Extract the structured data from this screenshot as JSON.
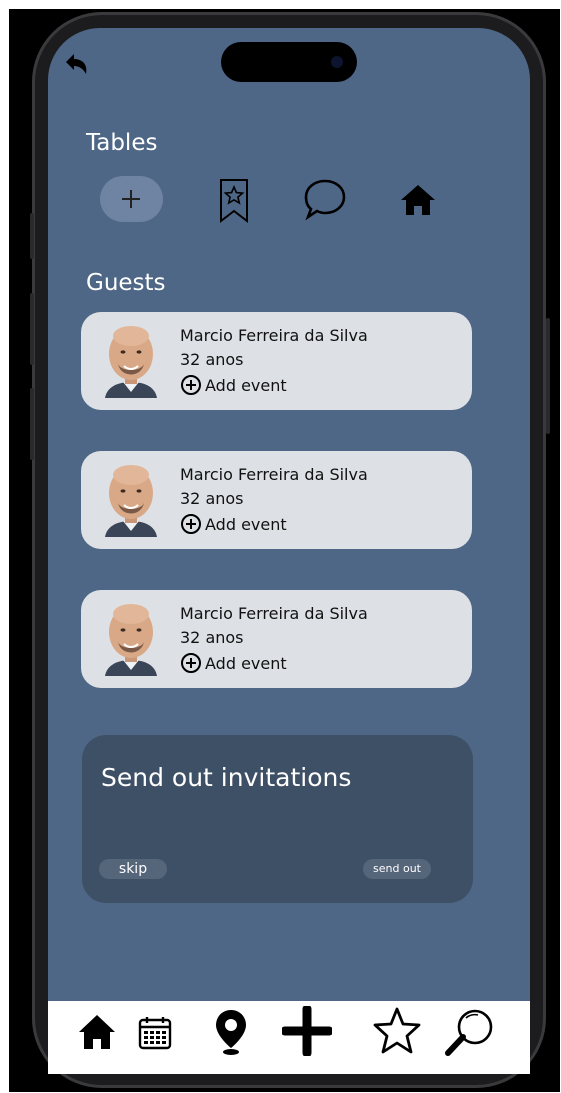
{
  "sections": {
    "tables_title": "Tables",
    "guests_title": "Guests"
  },
  "guests": [
    {
      "name": "Marcio Ferreira da Silva",
      "age": "32 anos",
      "action": "Add event"
    },
    {
      "name": "Marcio Ferreira da Silva",
      "age": "32 anos",
      "action": "Add event"
    },
    {
      "name": "Marcio Ferreira da Silva",
      "age": "32 anos",
      "action": "Add event"
    }
  ],
  "invitations": {
    "title": "Send out invitations",
    "skip_label": "skip",
    "send_label": "send out"
  },
  "icons": {
    "back": "undo-arrow-icon",
    "tables_row": [
      "plus-icon",
      "bookmark-star-icon",
      "chat-bubble-icon",
      "home-icon"
    ],
    "bottom_nav": [
      "home-icon",
      "calendar-icon",
      "map-pin-icon",
      "plus-icon",
      "star-icon",
      "search-icon"
    ]
  },
  "colors": {
    "screen_bg": "#4f6786",
    "card_bg": "#dde1e5",
    "invite_bg": "#3e5066",
    "pill_bg": "#6f84a2"
  }
}
